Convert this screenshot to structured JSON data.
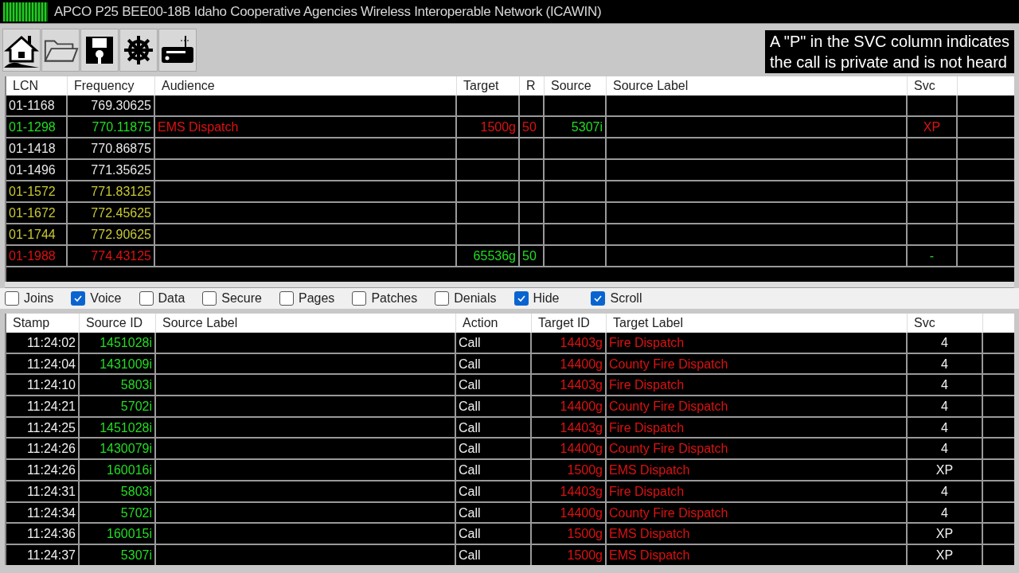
{
  "window": {
    "title": "APCO P25 BEE00-18B Idaho Cooperative Agencies Wireless Interoperable Network (ICAWIN)"
  },
  "toolbar": [
    {
      "kind": "home"
    },
    {
      "kind": "folder"
    },
    {
      "kind": "save"
    },
    {
      "kind": "wheel"
    },
    {
      "kind": "radio"
    }
  ],
  "caption": [
    "A \"P\" in the SVC column indicates",
    "the call is private and is not heard"
  ],
  "channels": {
    "columns": [
      "LCN",
      "Frequency",
      "Audience",
      "Target",
      "R",
      "Source",
      "Source Label",
      "Svc"
    ],
    "rows": [
      {
        "kind": "white",
        "cells": [
          "01-1168",
          "769.30625"
        ]
      },
      {
        "kind": "green",
        "cells": [
          "01-1298",
          "770.11875",
          "EMS Dispatch",
          "1500g",
          "50",
          "5307i",
          "",
          "XP"
        ]
      },
      {
        "kind": "white",
        "cells": [
          "01-1418",
          "770.86875"
        ]
      },
      {
        "kind": "white",
        "cells": [
          "01-1496",
          "771.35625"
        ]
      },
      {
        "kind": "yellow",
        "cells": [
          "01-1572",
          "771.83125"
        ]
      },
      {
        "kind": "yellow",
        "cells": [
          "01-1672",
          "772.45625"
        ]
      },
      {
        "kind": "yellow",
        "cells": [
          "01-1744",
          "772.90625"
        ]
      },
      {
        "kind": "red",
        "cells": [
          "01-1988",
          "774.43125",
          "",
          "65536g",
          "50",
          "",
          "",
          "-"
        ]
      }
    ]
  },
  "filters": [
    {
      "label": "Joins",
      "checked": false
    },
    {
      "label": "Voice",
      "checked": true
    },
    {
      "label": "Data",
      "checked": false
    },
    {
      "label": "Secure",
      "checked": false
    },
    {
      "label": "Pages",
      "checked": false
    },
    {
      "label": "Patches",
      "checked": false
    },
    {
      "label": "Denials",
      "checked": false
    },
    {
      "label": "Hide",
      "checked": true
    },
    {
      "label": "Scroll",
      "checked": true
    }
  ],
  "log": {
    "columns": [
      "Stamp",
      "Source ID",
      "Source Label",
      "Action",
      "Target ID",
      "Target Label",
      "Svc"
    ],
    "rows": [
      {
        "stamp": "11:24:02",
        "source_id": "1451028i",
        "action": "Call",
        "target_id": "14403g",
        "target_label": "Fire Dispatch",
        "svc": "4"
      },
      {
        "stamp": "11:24:04",
        "source_id": "1431009i",
        "action": "Call",
        "target_id": "14400g",
        "target_label": "County Fire Dispatch",
        "svc": "4"
      },
      {
        "stamp": "11:24:10",
        "source_id": "5803i",
        "action": "Call",
        "target_id": "14403g",
        "target_label": "Fire Dispatch",
        "svc": "4"
      },
      {
        "stamp": "11:24:21",
        "source_id": "5702i",
        "action": "Call",
        "target_id": "14400g",
        "target_label": "County Fire Dispatch",
        "svc": "4"
      },
      {
        "stamp": "11:24:25",
        "source_id": "1451028i",
        "action": "Call",
        "target_id": "14403g",
        "target_label": "Fire Dispatch",
        "svc": "4"
      },
      {
        "stamp": "11:24:26",
        "source_id": "1430079i",
        "action": "Call",
        "target_id": "14400g",
        "target_label": "County Fire Dispatch",
        "svc": "4"
      },
      {
        "stamp": "11:24:26",
        "source_id": "160016i",
        "action": "Call",
        "target_id": "1500g",
        "target_label": "EMS Dispatch",
        "svc": "XP"
      },
      {
        "stamp": "11:24:31",
        "source_id": "5803i",
        "action": "Call",
        "target_id": "14403g",
        "target_label": "Fire Dispatch",
        "svc": "4"
      },
      {
        "stamp": "11:24:34",
        "source_id": "5702i",
        "action": "Call",
        "target_id": "14400g",
        "target_label": "County Fire Dispatch",
        "svc": "4"
      },
      {
        "stamp": "11:24:36",
        "source_id": "160015i",
        "action": "Call",
        "target_id": "1500g",
        "target_label": "EMS Dispatch",
        "svc": "XP"
      },
      {
        "stamp": "11:24:37",
        "source_id": "5307i",
        "action": "Call",
        "target_id": "1500g",
        "target_label": "EMS Dispatch",
        "svc": "XP"
      }
    ]
  }
}
